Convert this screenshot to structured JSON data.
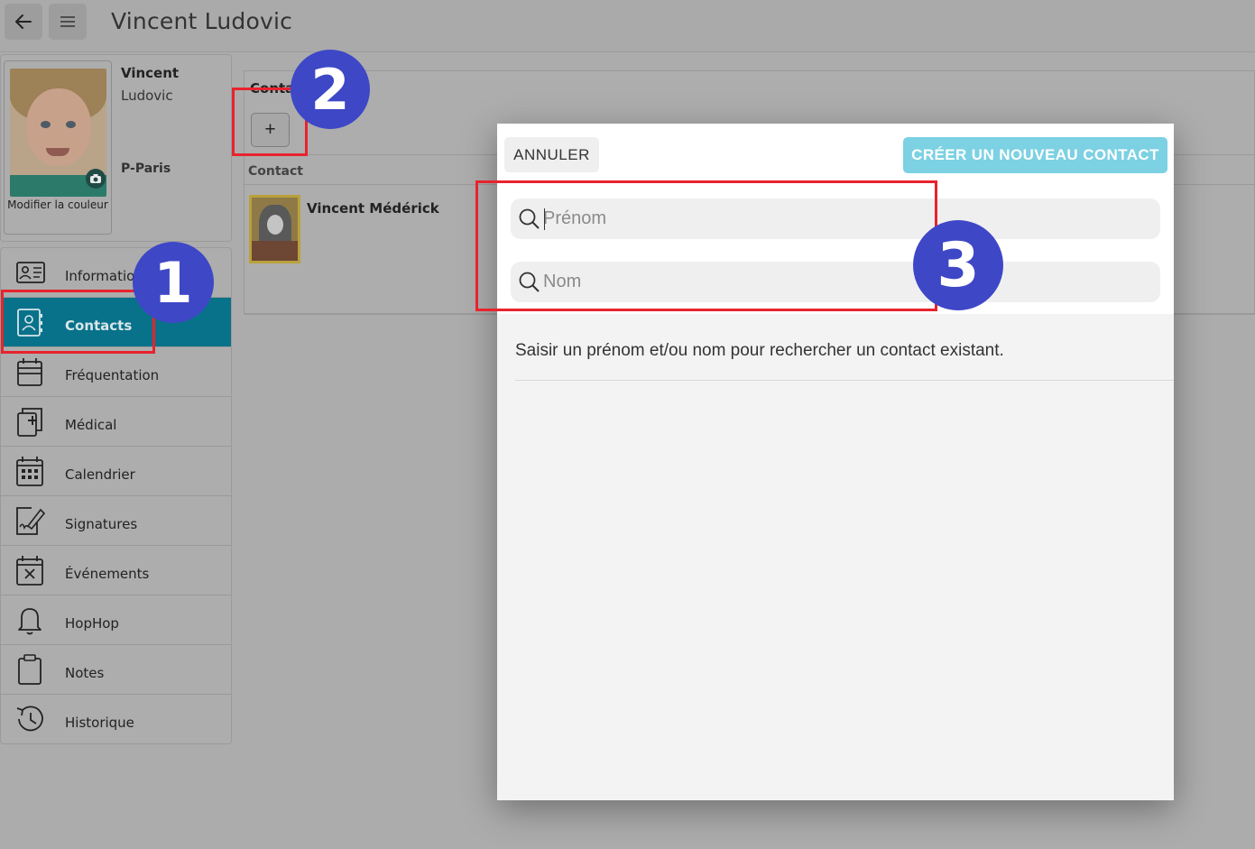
{
  "header": {
    "title": "Vincent Ludovic",
    "back_icon": "arrow-left-icon",
    "menu_icon": "hamburger-menu-icon"
  },
  "profile": {
    "first_name": "Vincent",
    "last_name": "Ludovic",
    "site": "P-Paris",
    "photo_caption": "Modifier la couleur",
    "camera_icon": "camera-icon"
  },
  "nav": {
    "items": [
      {
        "label": "Information",
        "icon": "id-card-icon"
      },
      {
        "label": "Contacts",
        "icon": "contacts-book-icon",
        "active": true
      },
      {
        "label": "Fréquentation",
        "icon": "attendance-icon"
      },
      {
        "label": "Médical",
        "icon": "medical-icon"
      },
      {
        "label": "Calendrier",
        "icon": "calendar-icon"
      },
      {
        "label": "Signatures",
        "icon": "signature-icon"
      },
      {
        "label": "Événements",
        "icon": "event-icon"
      },
      {
        "label": "HopHop",
        "icon": "bell-icon"
      },
      {
        "label": "Notes",
        "icon": "clipboard-icon"
      },
      {
        "label": "Historique",
        "icon": "history-icon"
      }
    ]
  },
  "contacts_panel": {
    "heading": "Conta",
    "add_label": "+",
    "column_header": "Contact",
    "rows": [
      {
        "name": "Vincent Médérick"
      }
    ]
  },
  "modal": {
    "cancel_label": "ANNULER",
    "create_label": "CRÉER UN NOUVEAU CONTACT",
    "first_name_placeholder": "Prénom",
    "last_name_placeholder": "Nom",
    "hint": "Saisir un prénom et/ou nom pour rechercher un contact existant."
  },
  "annotations": {
    "badges": [
      "1",
      "2",
      "3"
    ],
    "highlight_color": "#e8232d",
    "badge_color": "#3e47c6"
  },
  "colors": {
    "accent": "#08728a",
    "create_button": "#7cd1e3"
  }
}
